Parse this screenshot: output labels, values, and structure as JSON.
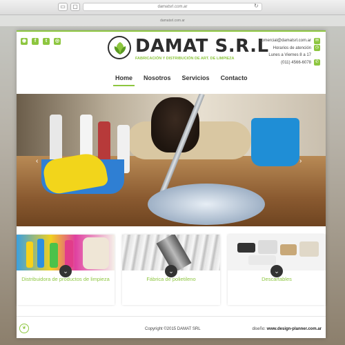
{
  "browser": {
    "url": "damatsrl.com.ar",
    "subtitle": "damatsrl.com.ar"
  },
  "header": {
    "social_icons": [
      "whatsapp-icon",
      "facebook-icon",
      "twitter-icon",
      "instagram-icon"
    ],
    "logo_name": "DAMAT S.R.L",
    "logo_tagline": "FABRICACIÓN Y DISTRIBUCIÓN DE ART. DE LIMPIEZA",
    "contact": {
      "email": "comercial@damatsrl.com.ar",
      "hours_label": "Horarios de atención",
      "hours": "Lunes a Viernes 8 a 17",
      "phone": "(011) 4566-6078"
    }
  },
  "nav": {
    "items": [
      {
        "label": "Home",
        "active": true
      },
      {
        "label": "Nosotros",
        "active": false
      },
      {
        "label": "Servicios",
        "active": false
      },
      {
        "label": "Contacto",
        "active": false
      }
    ]
  },
  "hero": {
    "prev_glyph": "‹",
    "next_glyph": "›"
  },
  "cards": [
    {
      "label": "Distribuidora de productos de limpieza"
    },
    {
      "label": "Fábrica de polietileno"
    },
    {
      "label": "Descartables"
    }
  ],
  "footer": {
    "copyright": "Copyright ©2015 DAMAT SRL",
    "design_prefix": "diseño:",
    "design_site": "www.design-planner.com.ar"
  },
  "colors": {
    "accent": "#8dc63f",
    "text": "#333333"
  }
}
